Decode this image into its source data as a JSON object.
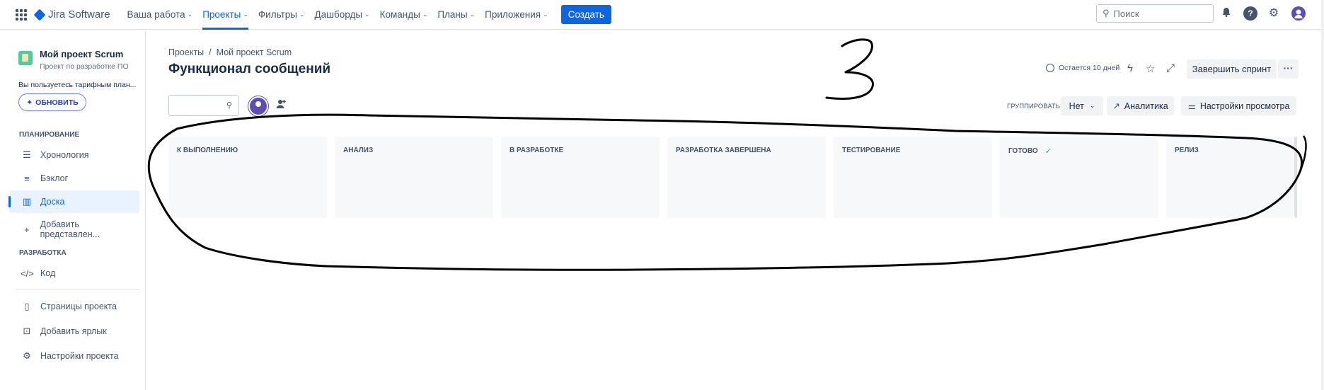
{
  "topnav": {
    "app_name": "Jira Software",
    "items": [
      {
        "label": "Ваша работа",
        "chevron": true,
        "active": false
      },
      {
        "label": "Проекты",
        "chevron": true,
        "active": true
      },
      {
        "label": "Фильтры",
        "chevron": true,
        "active": false
      },
      {
        "label": "Дашборды",
        "chevron": true,
        "active": false
      },
      {
        "label": "Команды",
        "chevron": true,
        "active": false
      },
      {
        "label": "Планы",
        "chevron": true,
        "active": false
      },
      {
        "label": "Приложения",
        "chevron": true,
        "active": false
      }
    ],
    "create_label": "Создать",
    "search_placeholder": "Поиск",
    "accent": "#0c66e4"
  },
  "sidebar": {
    "project_name": "Мой проект Scrum",
    "project_type": "Проект по разработке ПО",
    "plan_note": "Вы пользуетесь тарифным план...",
    "upgrade_label": "ОБНОВИТЬ",
    "planning_header": "ПЛАНИРОВАНИЕ",
    "planning_items": [
      {
        "label": "Хронология",
        "icon": "timeline-icon",
        "active": false
      },
      {
        "label": "Бэклог",
        "icon": "backlog-icon",
        "active": false
      },
      {
        "label": "Доска",
        "icon": "board-icon",
        "active": true
      }
    ],
    "add_view_label": "Добавить представлен...",
    "dev_header": "РАЗРАБОТКА",
    "code_label": "Код",
    "bottom_items": [
      {
        "label": "Страницы проекта",
        "icon": "pages-icon"
      },
      {
        "label": "Добавить ярлык",
        "icon": "add-shortcut-icon"
      },
      {
        "label": "Настройки проекта",
        "icon": "settings-icon"
      }
    ]
  },
  "main": {
    "breadcrumb": [
      "Проекты",
      "Мой проект Scrum"
    ],
    "title": "Функционал сообщений",
    "remaining": "Остается 10 дней",
    "complete_sprint_label": "Завершить спринт",
    "group_by_label": "ГРУППИРОВАТЬ:",
    "group_by_value": "Нет",
    "analytics_label": "Аналитика",
    "view_settings_label": "Настройки просмотра",
    "columns": [
      {
        "title": "К ВЫПОЛНЕНИЮ",
        "done": false
      },
      {
        "title": "АНАЛИЗ",
        "done": false
      },
      {
        "title": "В РАЗРАБОТКЕ",
        "done": false
      },
      {
        "title": "РАЗРАБОТКА ЗАВЕРШЕНА",
        "done": false
      },
      {
        "title": "ТЕСТИРОВАНИЕ",
        "done": false
      },
      {
        "title": "ГОТОВО",
        "done": true
      },
      {
        "title": "РЕЛИЗ",
        "done": false
      }
    ]
  },
  "annotation": {
    "handwritten_digit": "3",
    "ink_color": "#000000"
  }
}
